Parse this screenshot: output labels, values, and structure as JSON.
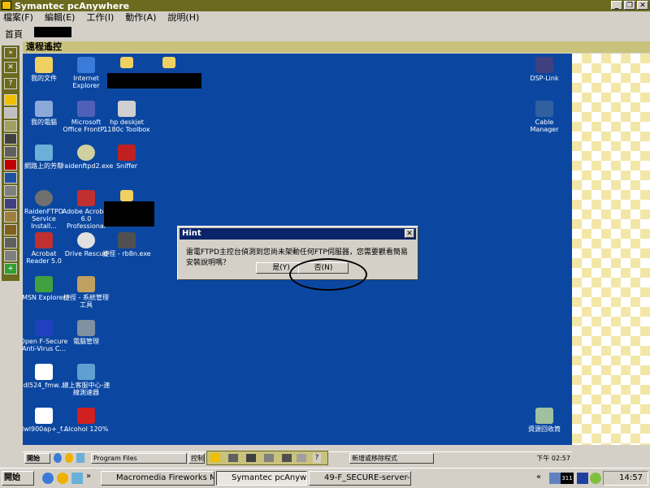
{
  "window": {
    "title": "Symantec pcAnywhere",
    "min": "_",
    "max": "❐",
    "close": "✕"
  },
  "menu": [
    "檔案(F)",
    "編輯(E)",
    "工作(I)",
    "動作(A)",
    "說明(H)"
  ],
  "nav": {
    "home": "首頁"
  },
  "panel": {
    "title": "遠程遙控"
  },
  "remote_desktop": {
    "icons": {
      "my_docs": "我的文件",
      "ie": "Internet Explorer",
      "my_computer": "我的電腦",
      "frontpage": "Microsoft Office FrontP...",
      "hp": "hp deskjet 1180c Toolbox",
      "network": "網路上的芳鄰",
      "raidenftpd2": "raidenftpd2.exe",
      "sniffer": "Sniffer",
      "raidenftpd": "RaidenFTPD Service Install...",
      "acrobat6": "Adobe Acrobat 6.0 Professional",
      "acrobat5": "Acrobat Reader 5.0",
      "drive_rescue": "Drive Rescue",
      "rb8n": "捷徑 - rb8n.exe",
      "msn": "MSN Explorer",
      "sys_admin": "捷徑 - 系統管理工具",
      "computer_mgmt": "電腦管理",
      "fsecure": "Open F-Secure Anti-Virus C...",
      "dl524": "dl524_fmw...",
      "online_service": "線上客服中心-連線測速器",
      "dwl900": "dwl900ap+_f...",
      "alcohol": "Alcohol 120%",
      "dsp_link": "DSP-Link",
      "cable_manager": "Cable Manager",
      "recycle": "資源回收筒"
    },
    "dialog": {
      "title": "Hint",
      "message": "雷電FTPD主控台偵測到您尚未架動任何FTP伺服器，您需要觀看簡易安裝說明嗎？",
      "yes": "是(Y)",
      "no": "否(N)"
    },
    "taskbar": {
      "start": "開始",
      "tasks": [
        "Program Files",
        "控制",
        "新增或移除程式"
      ],
      "clock": "下午 02:57"
    }
  },
  "taskbar": {
    "start": "開始",
    "tasks": [
      "Macromedia Fireworks M...",
      "Symantec pcAnywhere",
      "49-F_SECURE-server-5.5..."
    ],
    "clock": "14:57",
    "tray_badge": "311"
  }
}
